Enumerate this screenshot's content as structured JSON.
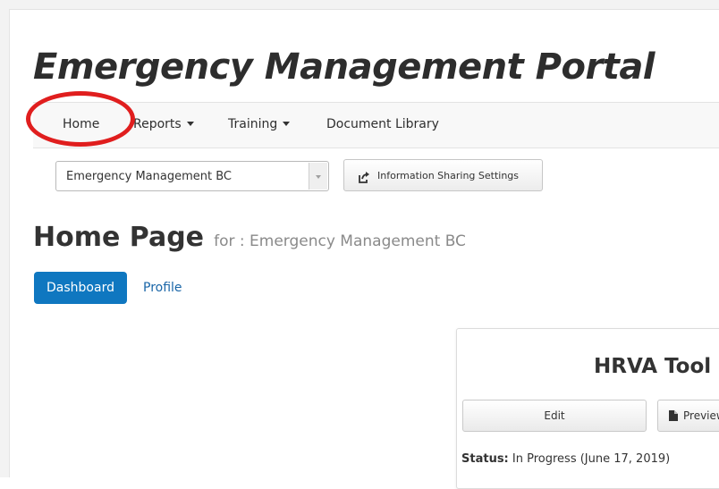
{
  "portal": {
    "title": "Emergency Management Portal"
  },
  "nav": {
    "items": [
      {
        "label": "Home"
      },
      {
        "label": "Reports"
      },
      {
        "label": "Training"
      },
      {
        "label": "Document Library"
      }
    ]
  },
  "org_select": {
    "value": "Emergency Management BC"
  },
  "share_button": {
    "label": "Information Sharing Settings",
    "icon": "share-arrow-icon"
  },
  "page": {
    "title": "Home Page",
    "subtitle": "for : Emergency Management BC"
  },
  "tabs": [
    {
      "label": "Dashboard",
      "active": true
    },
    {
      "label": "Profile",
      "active": false
    }
  ],
  "card": {
    "title": "HRVA Tool",
    "edit_label": "Edit",
    "preview_label": "Preview",
    "status_label": "Status:",
    "status_value": "In Progress (June 17, 2019)"
  },
  "colors": {
    "accent": "#0f77c0",
    "highlight_circle": "#e01e1e",
    "link": "#1a66a8"
  }
}
